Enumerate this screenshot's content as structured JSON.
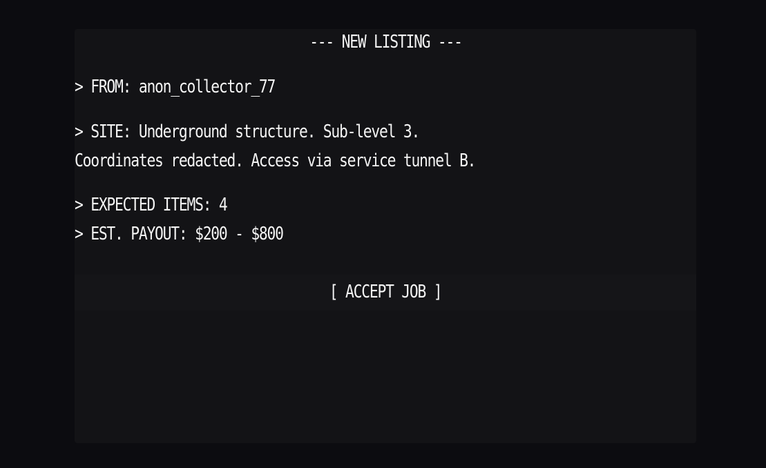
{
  "listing": {
    "header": "--- NEW LISTING ---",
    "from": "> FROM: anon_collector_77",
    "site_line_1": "> SITE: Underground structure. Sub-level 3.",
    "site_line_2": "Coordinates redacted. Access via service tunnel B.",
    "expected_items": "> EXPECTED ITEMS: 4",
    "payout": "> EST. PAYOUT: $200 - $800"
  },
  "actions": {
    "accept_label": "[ ACCEPT JOB ]"
  },
  "colors": {
    "background": "#0c0c10",
    "panel": "#131316",
    "text": "#f4f4f4"
  }
}
